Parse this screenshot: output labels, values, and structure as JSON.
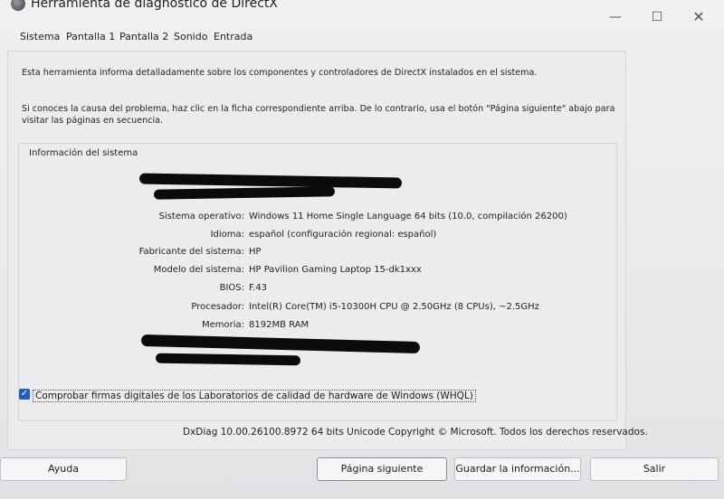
{
  "window": {
    "title": "Herramienta de diagnóstico de DirectX",
    "minimize_symbol": "—",
    "maximize_symbol": "☐",
    "close_symbol": "✕"
  },
  "tabs": [
    {
      "label": "Sistema"
    },
    {
      "label": "Pantalla 1"
    },
    {
      "label": "Pantalla 2"
    },
    {
      "label": "Sonido"
    },
    {
      "label": "Entrada"
    }
  ],
  "intro": {
    "line1": "Esta herramienta informa detalladamente sobre los componentes y controladores de DirectX instalados en el sistema.",
    "line2": "Si conoces la causa del problema, haz clic en la ficha correspondiente arriba. De lo contrario, usa el botón \"Página siguiente\" abajo para",
    "line3": "visitar las páginas en secuencia."
  },
  "system_info": {
    "group_label": "Información del sistema",
    "rows": [
      {
        "label": "Sistema operativo:",
        "value": "Windows 11 Home Single Language 64 bits (10.0, compilación 26200)"
      },
      {
        "label": "Idioma:",
        "value": "español (configuración regional: español)"
      },
      {
        "label": "Fabricante del sistema:",
        "value": "HP"
      },
      {
        "label": "Modelo del sistema:",
        "value": "HP Pavilion Gaming Laptop 15-dk1xxx"
      },
      {
        "label": "BIOS:",
        "value": "F.43"
      },
      {
        "label": "Procesador:",
        "value": "Intel(R) Core(TM) i5-10300H CPU @ 2.50GHz (8 CPUs), ~2.5GHz"
      },
      {
        "label": "Memoria:",
        "value": "8192MB RAM"
      }
    ]
  },
  "whql": {
    "checked": true,
    "check_symbol": "✓",
    "label": "Comprobar firmas digitales de los Laboratorios de calidad de hardware de Windows (WHQL)"
  },
  "footer": "DxDiag 10.00.26100.8972 64 bits Unicode  Copyright © Microsoft. Todos los derechos reservados.",
  "buttons": {
    "help": "Ayuda",
    "next_page": "Página siguiente",
    "save_info": "Guardar la información...",
    "exit": "Salir"
  }
}
